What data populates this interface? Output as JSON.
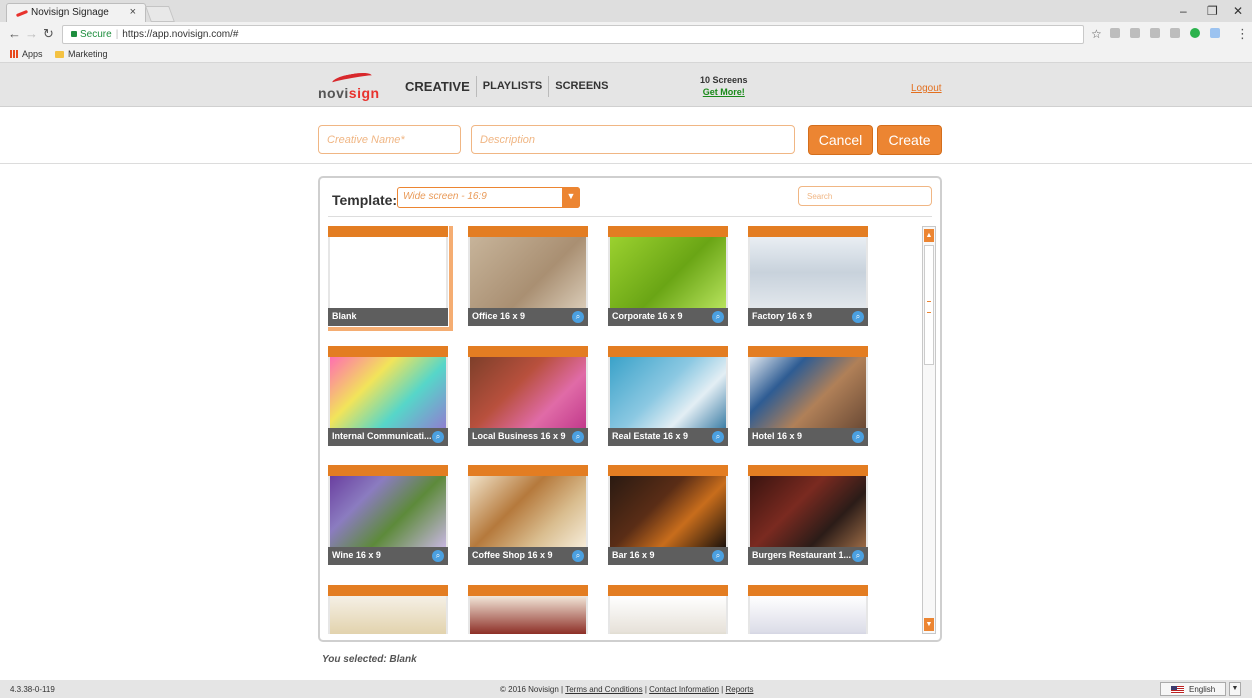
{
  "browser": {
    "tab_title": "Novisign Signage",
    "tab_close": "×",
    "url_secure": "Secure",
    "url": "https://app.novisign.com/#",
    "minimize": "–",
    "restore": "❐",
    "close": "✕",
    "bookmarks": [
      "Apps",
      "Marketing"
    ]
  },
  "header": {
    "logo_text_a": "novi",
    "logo_text_b": "sign",
    "nav": [
      "CREATIVE",
      "PLAYLISTS",
      "SCREENS"
    ],
    "screens_count": "10 Screens",
    "get_more": "Get More!",
    "logout": "Logout"
  },
  "form": {
    "name_placeholder": "Creative Name*",
    "description_placeholder": "Description",
    "cancel": "Cancel",
    "create": "Create"
  },
  "template": {
    "label": "Template:",
    "select_value": "Wide screen - 16:9",
    "search_placeholder": "Search",
    "items": [
      {
        "name": "Blank",
        "theme": "blank"
      },
      {
        "name": "Office 16 x 9",
        "theme": "office"
      },
      {
        "name": "Corporate 16 x 9",
        "theme": "corporate"
      },
      {
        "name": "Factory 16 x 9",
        "theme": "factory"
      },
      {
        "name": "Internal Communicati...",
        "theme": "internal"
      },
      {
        "name": "Local Business 16 x 9",
        "theme": "local"
      },
      {
        "name": "Real Estate 16 x 9",
        "theme": "realestate"
      },
      {
        "name": "Hotel 16 x 9",
        "theme": "hotel"
      },
      {
        "name": "Wine 16 x 9",
        "theme": "wine"
      },
      {
        "name": "Coffee Shop 16 x 9",
        "theme": "coffee"
      },
      {
        "name": "Bar 16 x 9",
        "theme": "bar"
      },
      {
        "name": "Burgers Restaurant 1...",
        "theme": "burgers"
      },
      {
        "name": "",
        "theme": "row4a"
      },
      {
        "name": "",
        "theme": "row4b"
      },
      {
        "name": "",
        "theme": "row4c"
      },
      {
        "name": "",
        "theme": "row4d"
      }
    ],
    "selected_text": "You selected: Blank"
  },
  "footer": {
    "version": "4.3.38-0-119",
    "copyright": "© 2016 Novisign",
    "terms": "Terms and Conditions",
    "contact": "Contact Information",
    "reports": "Reports",
    "language": "English"
  },
  "colors": {
    "accent": "#ec8532",
    "caption": "#5e5e5e"
  }
}
